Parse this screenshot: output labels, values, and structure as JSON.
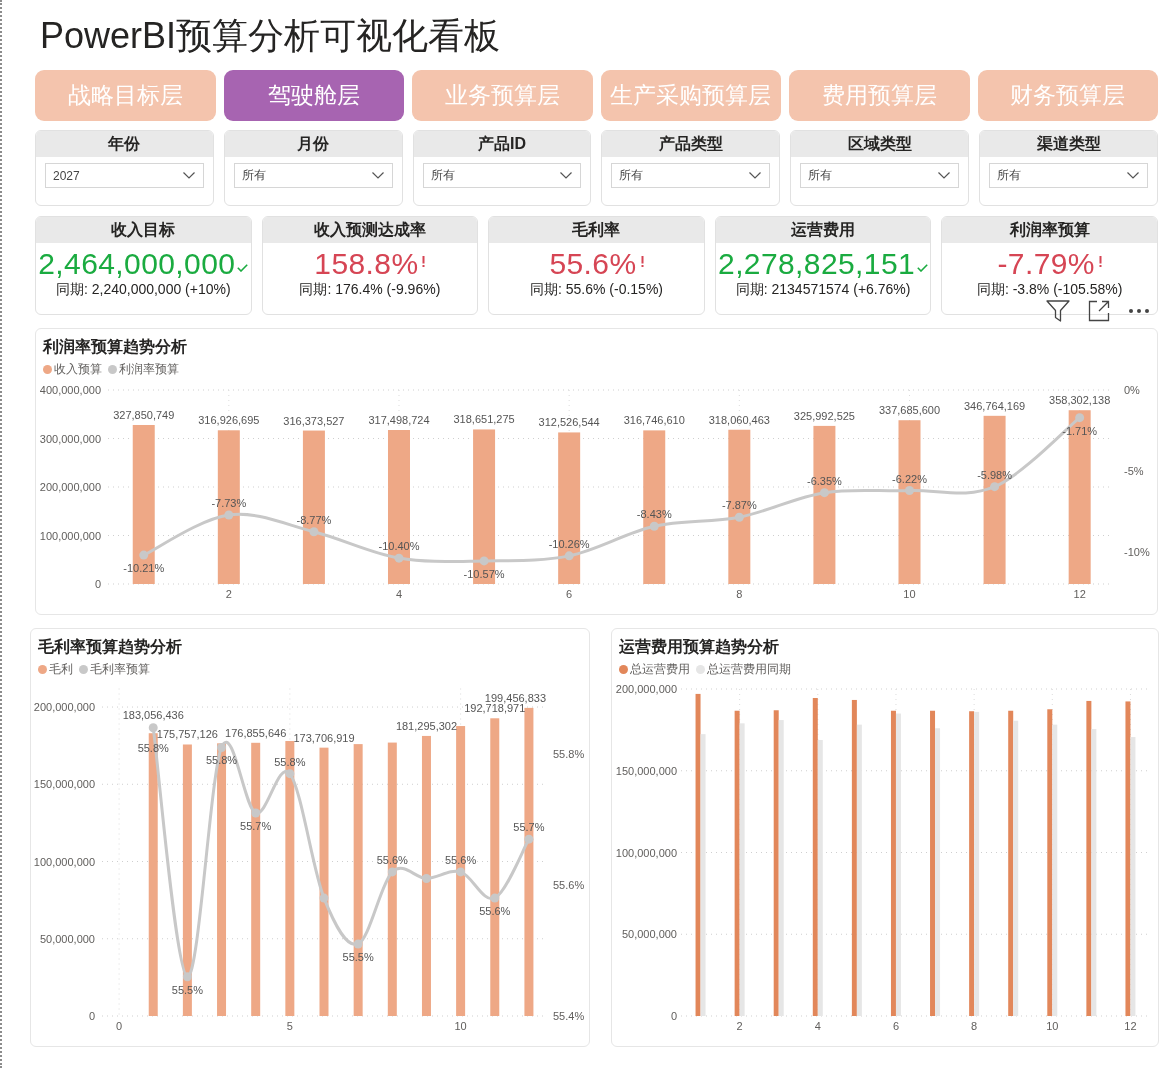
{
  "title": "PowerBI预算分析可视化看板",
  "tabs": [
    {
      "label": "战略目标层",
      "selected": false
    },
    {
      "label": "驾驶舱层",
      "selected": true
    },
    {
      "label": "业务预算层",
      "selected": false
    },
    {
      "label": "生产采购预算层",
      "selected": false
    },
    {
      "label": "费用预算层",
      "selected": false
    },
    {
      "label": "财务预算层",
      "selected": false
    }
  ],
  "filters": [
    {
      "label": "年份",
      "value": "2027"
    },
    {
      "label": "月份",
      "value": "所有"
    },
    {
      "label": "产品ID",
      "value": "所有"
    },
    {
      "label": "产品类型",
      "value": "所有"
    },
    {
      "label": "区域类型",
      "value": "所有"
    },
    {
      "label": "渠道类型",
      "value": "所有"
    }
  ],
  "kpis": [
    {
      "label": "收入目标",
      "value": "2,464,000,000",
      "on_target": true,
      "comparison": "同期: 2,240,000,000 (+10%)"
    },
    {
      "label": "收入预测达成率",
      "value": "158.8%",
      "on_target": false,
      "comparison": "同期: 176.4% (-9.96%)"
    },
    {
      "label": "毛利率",
      "value": "55.6%",
      "on_target": false,
      "comparison": "同期: 55.6% (-0.15%)"
    },
    {
      "label": "运营费用",
      "value": "2,278,825,151",
      "on_target": true,
      "comparison": "同期: 2134571574 (+6.76%)"
    },
    {
      "label": "利润率预算",
      "value": "-7.79%",
      "on_target": false,
      "comparison": "同期: -3.8% (-105.58%)"
    }
  ],
  "charts": [
    {
      "chart_data": {
        "type": "bar",
        "title": "利润率预算趋势分析",
        "x": [
          1,
          2,
          3,
          4,
          5,
          6,
          7,
          8,
          9,
          10,
          11,
          12
        ],
        "xlim": [
          0.58,
          12.38
        ],
        "ylim": [
          0,
          400000000
        ],
        "y2lim": [
          -12,
          0
        ],
        "grid": true,
        "xticks": [
          2,
          4,
          6,
          8,
          10,
          12
        ],
        "yticks": [
          {
            "value": 0,
            "label": "0"
          },
          {
            "value": 100000000,
            "label": "100,000,000"
          },
          {
            "value": 200000000,
            "label": "200,000,000"
          },
          {
            "value": 300000000,
            "label": "300,000,000"
          },
          {
            "value": 400000000,
            "label": "400,000,000"
          }
        ],
        "y2ticks": [
          {
            "value": 0,
            "label": "0%"
          },
          {
            "value": -5,
            "label": "-5%"
          },
          {
            "value": -10,
            "label": "-10%"
          }
        ],
        "series": [
          {
            "name": "收入预算",
            "type": "bar",
            "color": "#eea886",
            "values": [
              327850749,
              316926695,
              316373527,
              317498724,
              318651275,
              312526544,
              316746610,
              318060463,
              325992525,
              337685600,
              346764169,
              358302138
            ],
            "value_labels": [
              "327,850,749",
              "316,926,695",
              "316,373,527",
              "317,498,724",
              "318,651,275",
              "312,526,544",
              "316,746,610",
              "318,060,463",
              "325,992,525",
              "337,685,600",
              "346,764,169",
              "358,302,138"
            ]
          },
          {
            "name": "利润率预算",
            "type": "line",
            "axis": "y2",
            "marker": true,
            "color": "#c8c8c8",
            "values": [
              -10.21,
              -7.73,
              -8.77,
              -10.4,
              -10.57,
              -10.26,
              -8.43,
              -7.87,
              -6.35,
              -6.22,
              -5.98,
              -1.71
            ],
            "value_labels": [
              "-10.21%",
              "-7.73%",
              "-8.77%",
              "-10.40%",
              "-10.57%",
              "-10.26%",
              "-8.43%",
              "-7.87%",
              "-6.35%",
              "-6.22%",
              "-5.98%",
              "-1.71%"
            ]
          }
        ]
      }
    },
    {
      "chart_data": {
        "type": "bar",
        "title": "毛利率预算趋势分析",
        "x": [
          1,
          2,
          3,
          4,
          5,
          6,
          7,
          8,
          9,
          10,
          11,
          12
        ],
        "xlim": [
          -0.5,
          12.5
        ],
        "ylim": [
          0,
          212000000
        ],
        "y2lim": [
          55.4,
          55.9
        ],
        "grid": true,
        "xticks": [
          0,
          5,
          10
        ],
        "yticks": [
          {
            "value": 0,
            "label": "0"
          },
          {
            "value": 50000000,
            "label": "50,000,000"
          },
          {
            "value": 100000000,
            "label": "100,000,000"
          },
          {
            "value": 150000000,
            "label": "150,000,000"
          },
          {
            "value": 200000000,
            "label": "200,000,000"
          }
        ],
        "y2ticks": [
          {
            "value": 55.4,
            "label": "55.4%"
          },
          {
            "value": 55.6,
            "label": "55.6%"
          },
          {
            "value": 55.8,
            "label": "55.8%"
          }
        ],
        "series": [
          {
            "name": "毛利",
            "type": "bar",
            "color": "#eea886",
            "values": [
              183056436,
              175757126,
              176500000,
              176855646,
              178000000,
              173706919,
              176000000,
              177000000,
              181295302,
              187700000,
              192718971,
              199456833
            ],
            "value_labels": [
              "183,056,436",
              "175,757,126",
              null,
              "176,855,646",
              null,
              "173,706,919",
              null,
              null,
              "181,295,302",
              null,
              "192,718,971",
              "199,456,833"
            ]
          },
          {
            "name": "毛利率预算",
            "type": "line",
            "axis": "y2",
            "marker": true,
            "color": "#c8c8c8",
            "values": [
              55.84,
              55.46,
              55.81,
              55.71,
              55.77,
              55.58,
              55.51,
              55.62,
              55.61,
              55.62,
              55.58,
              55.67
            ],
            "value_labels": [
              "55.8%",
              "55.5%",
              "55.8%",
              "55.7%",
              "55.8%",
              null,
              "55.5%",
              "55.6%",
              null,
              "55.6%",
              "55.6%",
              "55.7%"
            ]
          }
        ]
      }
    },
    {
      "chart_data": {
        "type": "bar",
        "title": "运营费用预算趋势分析",
        "x": [
          1,
          2,
          3,
          4,
          5,
          6,
          7,
          8,
          9,
          10,
          11,
          12
        ],
        "xlim": [
          0.5,
          12.5
        ],
        "ylim": [
          0,
          200000000
        ],
        "grid": true,
        "xticks": [
          2,
          4,
          6,
          8,
          10,
          12
        ],
        "yticks": [
          {
            "value": 0,
            "label": "0"
          },
          {
            "value": 50000000,
            "label": "50,000,000"
          },
          {
            "value": 100000000,
            "label": "100,000,000"
          },
          {
            "value": 150000000,
            "label": "150,000,000"
          },
          {
            "value": 200000000,
            "label": "200,000,000"
          }
        ],
        "series": [
          {
            "name": "总运营费用",
            "type": "bar",
            "color": "#e2875a",
            "values": [
              197000000,
              186700000,
              187000000,
              194500000,
              193300000,
              186700000,
              186700000,
              186400000,
              186700000,
              187600000,
              192700000,
              192400000
            ]
          },
          {
            "name": "总运营费用同期",
            "type": "bar",
            "color": "#e6e6e6",
            "values": [
              172400000,
              179000000,
              181000000,
              168800000,
              178200000,
              185000000,
              176000000,
              186000000,
              180600000,
              178200000,
              175500000,
              170600000
            ]
          }
        ]
      }
    }
  ]
}
